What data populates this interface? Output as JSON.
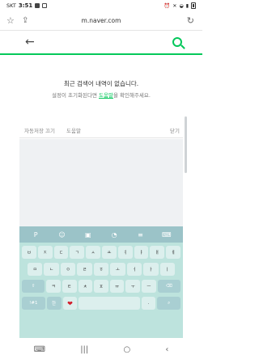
{
  "status_bar": {
    "carrier": "SKT",
    "time": "3:51"
  },
  "browser": {
    "url": "m.naver.com"
  },
  "search": {
    "placeholder": ""
  },
  "empty_state": {
    "title": "최근 검색어 내역이 없습니다.",
    "subtitle_before": "설정이 초기화된다면 ",
    "help_link": "도움말",
    "subtitle_after": "을 확인해주세요."
  },
  "options": {
    "autosave_off": "자동저장 끄기",
    "help": "도움말",
    "close": "닫기"
  },
  "keyboard": {
    "toolbar_icons": [
      "naver-p-icon",
      "emoji-icon",
      "sticker-icon",
      "clip-icon",
      "settings-icon",
      "translate-icon"
    ],
    "rows": [
      [
        "ㅂ",
        "ㅈ",
        "ㄷ",
        "ㄱ",
        "ㅅ",
        "ㅛ",
        "ㅕ",
        "ㅑ",
        "ㅐ",
        "ㅔ"
      ],
      [
        "ㅁ",
        "ㄴ",
        "ㅇ",
        "ㄹ",
        "ㅎ",
        "ㅗ",
        "ㅓ",
        "ㅏ",
        "ㅣ"
      ],
      [
        "ㅋ",
        "ㅌ",
        "ㅊ",
        "ㅍ",
        "ㅠ",
        "ㅜ",
        "ㅡ"
      ]
    ],
    "bottom": {
      "lang": "!#1",
      "globe": "한",
      "comma": ",",
      "period": "."
    }
  }
}
